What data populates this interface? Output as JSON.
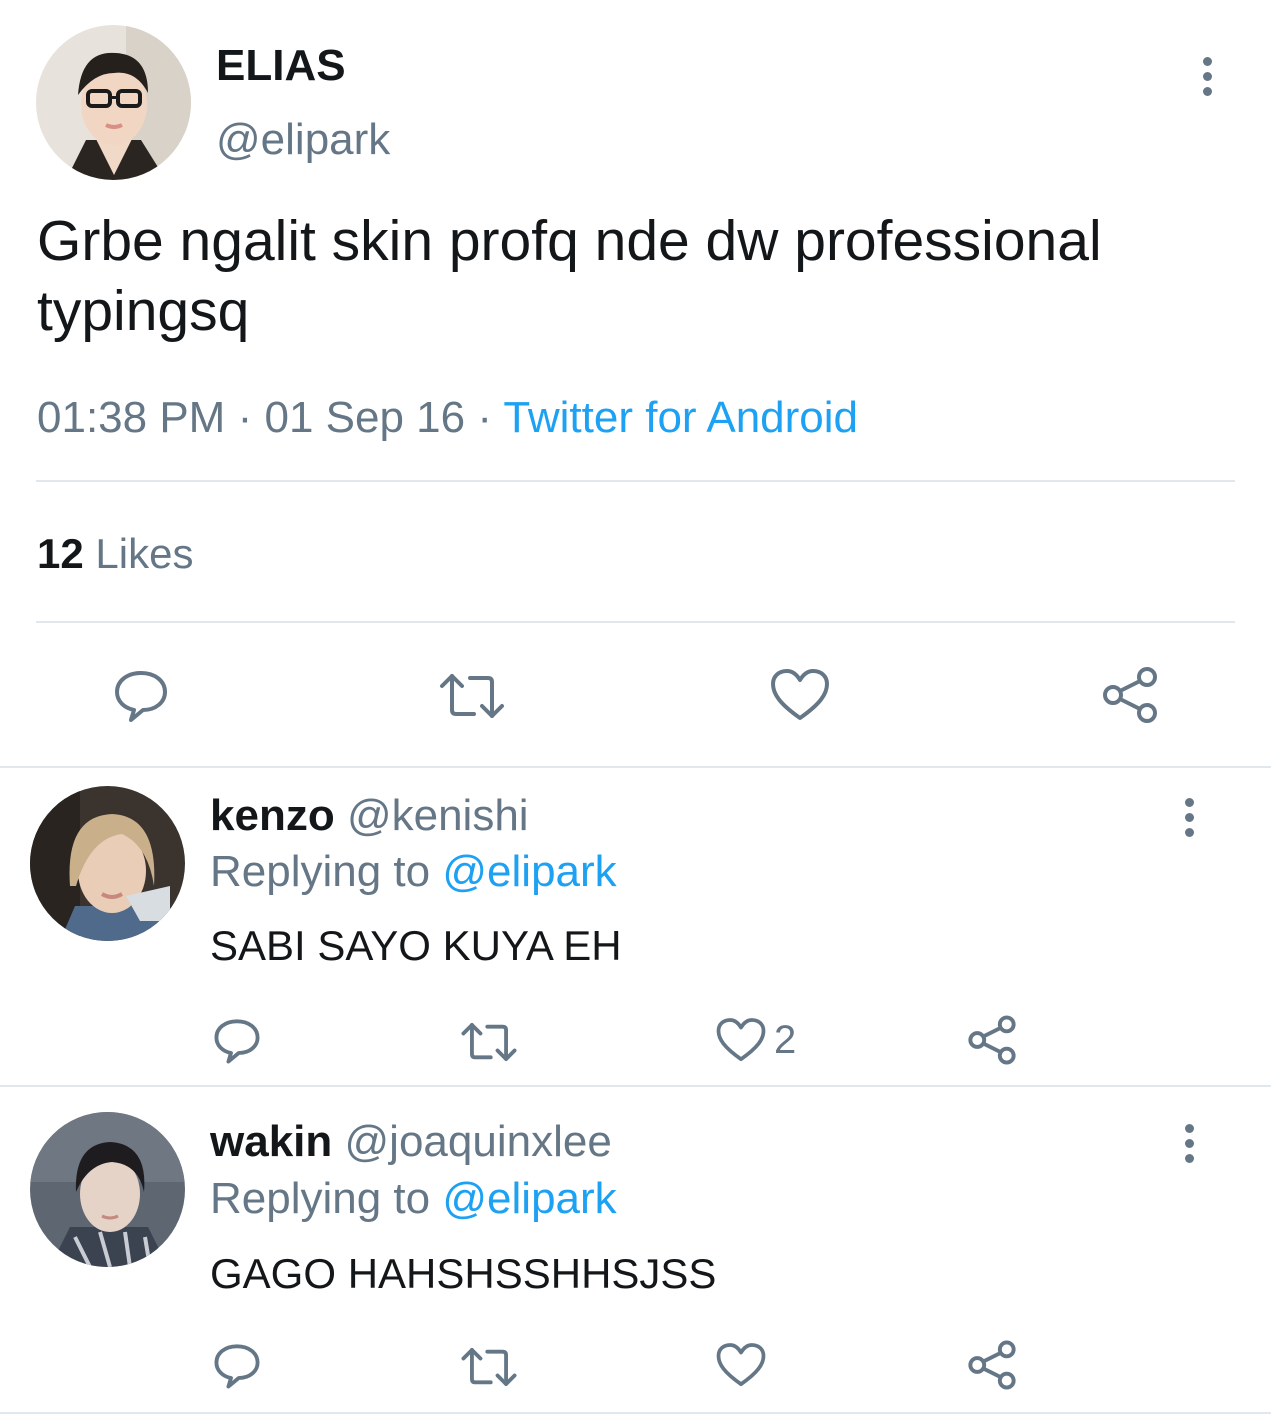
{
  "tweet": {
    "display_name": "ELIAS",
    "handle": "@elipark",
    "text": "Grbe ngalit skin profq nde dw professional typingsq",
    "time": "01:38 PM",
    "date": "01 Sep 16",
    "separator": "·",
    "source": "Twitter for Android",
    "likes_count": "12",
    "likes_label": "Likes"
  },
  "replies": [
    {
      "display_name": "kenzo",
      "handle": "@kenishi",
      "replying_label": "Replying to",
      "replying_handle": "@elipark",
      "text": "SABI SAYO KUYA EH",
      "like_count": "2"
    },
    {
      "display_name": "wakin",
      "handle": "@joaquinxlee",
      "replying_label": "Replying to",
      "replying_handle": "@elipark",
      "text": "GAGO HAHSHSSHHSJSS",
      "like_count": ""
    }
  ],
  "colors": {
    "text": "#14171a",
    "secondary": "#657786",
    "link": "#1da1f2",
    "divider": "#e1e8ed"
  },
  "icons": [
    "more-vertical-icon",
    "reply-icon",
    "retweet-icon",
    "like-icon",
    "share-icon"
  ]
}
